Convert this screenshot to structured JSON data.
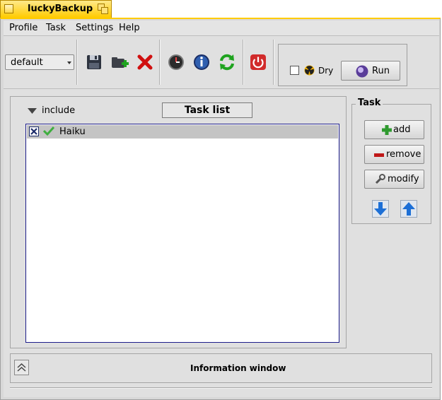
{
  "window": {
    "title": "luckyBackup"
  },
  "menu": {
    "items": [
      "Profile",
      "Task",
      "Settings",
      "Help"
    ]
  },
  "toolbar": {
    "profile_selected": "default",
    "icons": [
      "save-icon",
      "new-profile-icon",
      "delete-icon",
      "schedule-icon",
      "info-icon",
      "refresh-icon",
      "quit-icon"
    ],
    "dry_label": "Dry",
    "dry_checked": false,
    "run_label": "Run"
  },
  "main": {
    "include_label": "include",
    "tasklist_title": "Task list",
    "tasks": [
      {
        "name": "Haiku",
        "checked": true,
        "status": "ok"
      }
    ]
  },
  "task_panel": {
    "title": "Task",
    "add_label": "add",
    "remove_label": "remove",
    "modify_label": "modify"
  },
  "info": {
    "label": "Information window"
  },
  "colors": {
    "title_tab": "#ffcb00",
    "selection": "#c4c4c4",
    "list_border": "#1c1c8a"
  }
}
